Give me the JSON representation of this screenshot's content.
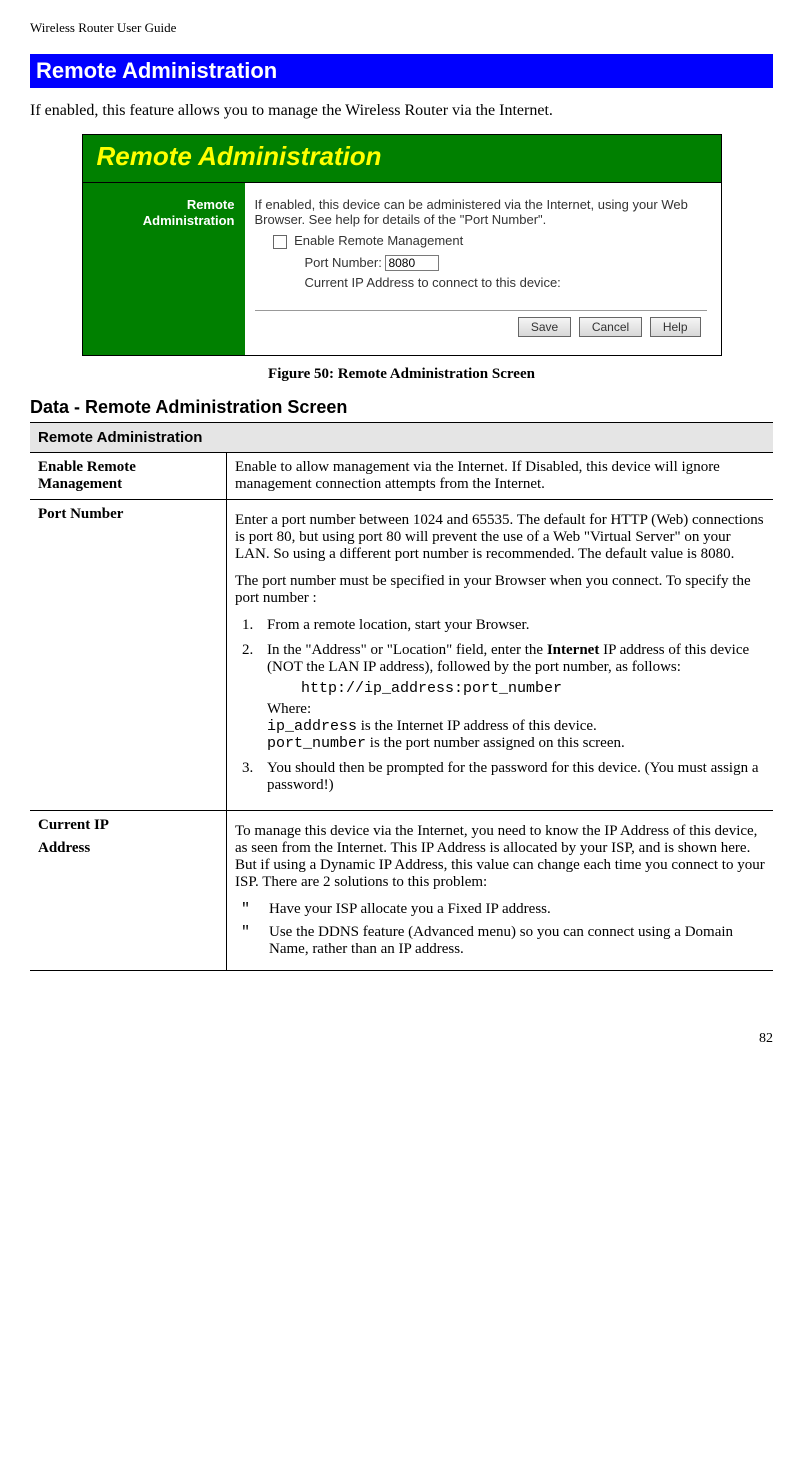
{
  "header": "Wireless Router User Guide",
  "section_title": "Remote Administration",
  "intro": "If enabled, this feature allows you to manage the Wireless Router via the Internet.",
  "figure": {
    "title": "Remote Administration",
    "sidebar_label": "Remote Administration",
    "help_text": "If enabled, this device can be administered via the Internet, using your Web Browser. See help for details of the \"Port Number\".",
    "checkbox_label": "Enable Remote Management",
    "port_label": "Port Number:",
    "port_value": "8080",
    "current_ip_label": "Current IP Address to connect to this device:",
    "buttons": {
      "save": "Save",
      "cancel": "Cancel",
      "help": "Help"
    },
    "caption": "Figure 50: Remote Administration Screen"
  },
  "data_section": {
    "heading": "Data - Remote Administration Screen",
    "table_header": "Remote Administration",
    "rows": {
      "enable": {
        "label": "Enable Remote Management",
        "desc": "Enable to allow management via the Internet. If Disabled, this device will ignore management connection attempts from the Internet."
      },
      "port": {
        "label": "Port Number",
        "p1": "Enter a port number between 1024 and 65535. The default for HTTP (Web) connections is port 80, but using port 80 will prevent the use of a Web \"Virtual Server\" on your LAN. So using a different port number is recommended. The default value is 8080.",
        "p2": "The port number must be specified in your Browser when you connect. To specify the port number :",
        "step1": "From a remote location, start your Browser.",
        "step2_a": "In the \"Address\" or \"Location\" field, enter the ",
        "step2_bold": "Internet",
        "step2_b": " IP address of this device (NOT the LAN IP address), followed by the port number, as follows:",
        "code": "http://ip_address:port_number",
        "where_label": "Where:",
        "where_ip_code": "ip_address",
        "where_ip_tail": " is the Internet IP address of this device.",
        "where_port_code": "port_number",
        "where_port_tail": " is the port number assigned on this screen.",
        "step3": "You should then be prompted for the password for this device. (You must assign a password!)"
      },
      "current_ip": {
        "label_line1": "Current IP",
        "label_line2": "Address",
        "p1": "To manage this device via the Internet, you need to know the IP Address of this device, as seen from the Internet. This IP Address is allocated by your ISP, and is shown here. But if using a Dynamic IP Address, this value can change each time you connect to your ISP. There are 2 solutions to this problem:",
        "bullet1": "Have your ISP allocate you a Fixed IP address.",
        "bullet2": "Use the DDNS feature (Advanced menu) so you can connect using a Domain Name, rather than an IP address."
      }
    }
  },
  "page_number": "82"
}
